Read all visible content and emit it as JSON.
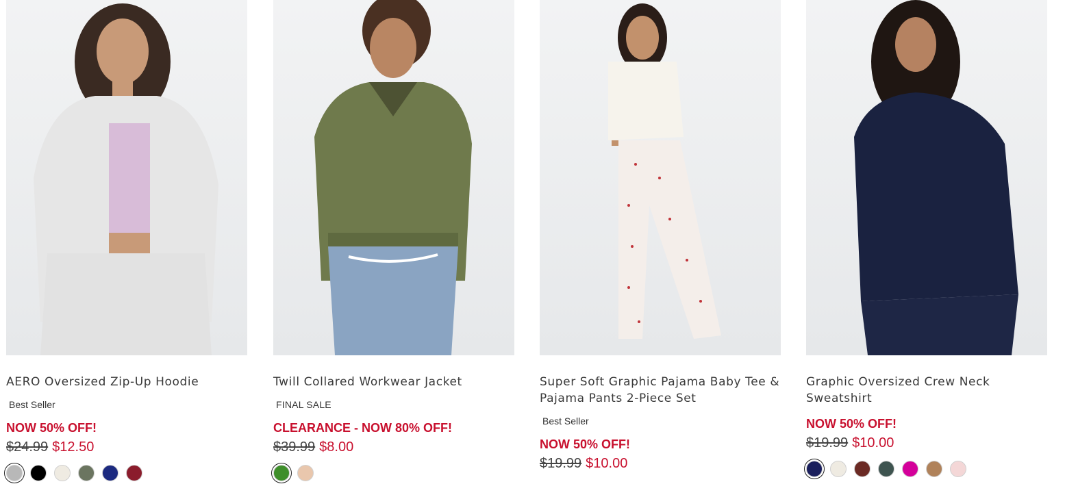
{
  "products": [
    {
      "title": "AERO Oversized Zip-Up Hoodie",
      "badge": "Best Seller",
      "promo": "NOW 50% OFF!",
      "was_price": "$24.99",
      "now_price": "$12.50",
      "swatches": [
        "#b8b8b8",
        "#000000",
        "#efebe2",
        "#6b7560",
        "#1c2a80",
        "#8b1c2c"
      ]
    },
    {
      "title": "Twill Collared Workwear Jacket",
      "badge": "FINAL SALE",
      "promo": "CLEARANCE - NOW 80% OFF!",
      "was_price": "$39.99",
      "now_price": "$8.00",
      "swatches": [
        "#3e8e2a",
        "#e9c7ad"
      ]
    },
    {
      "title": "Super Soft Graphic Pajama Baby Tee & Pajama Pants 2-Piece Set",
      "badge": "Best Seller",
      "promo": "NOW 50% OFF!",
      "was_price": "$19.99",
      "now_price": "$10.00",
      "swatches": []
    },
    {
      "title": "Graphic Oversized Crew Neck Sweatshirt",
      "badge": "",
      "promo": "NOW 50% OFF!",
      "was_price": "$19.99",
      "now_price": "$10.00",
      "swatches": [
        "#1a1f5c",
        "#efebe2",
        "#6b2a24",
        "#3e5450",
        "#d4009a",
        "#b0825a",
        "#f4d7d7"
      ]
    }
  ],
  "colors": {
    "sale_red": "#c8102e"
  }
}
